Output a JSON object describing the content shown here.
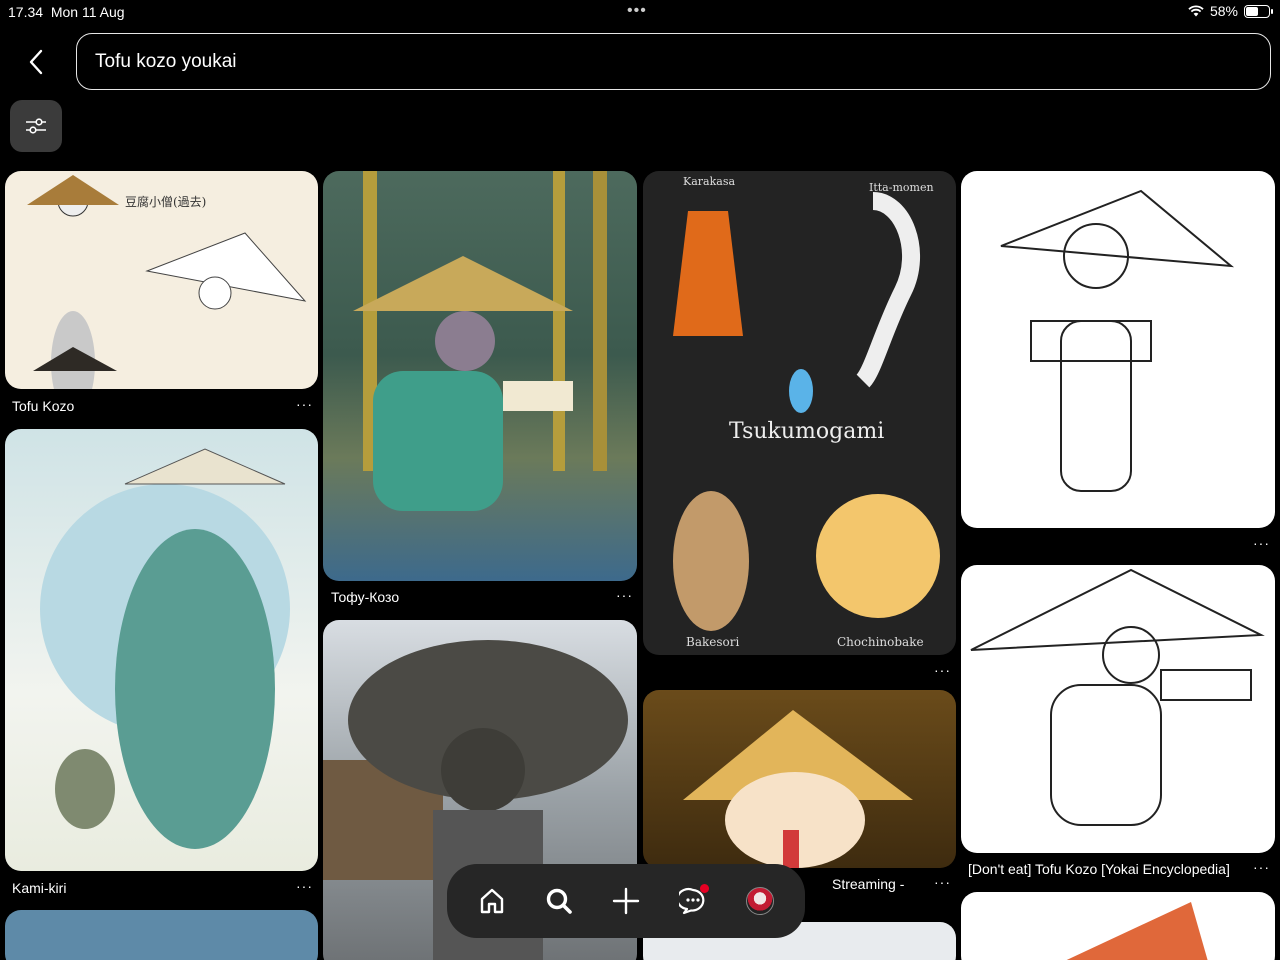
{
  "status": {
    "time": "17.34",
    "date": "Mon 11 Aug",
    "battery": "58%",
    "battery_level": 0.58
  },
  "search": {
    "value": "Tofu kozo youkai"
  },
  "pins": [
    {
      "caption": "Tofu Kozo"
    },
    {
      "caption": "Kami-kiri"
    },
    {
      "caption": "Тофу-Козо"
    },
    {
      "caption": ""
    },
    {
      "caption": ""
    },
    {
      "caption": "Streaming  -"
    },
    {
      "caption": ""
    },
    {
      "caption": "[Don't eat] Tofu Kozo [Yokai Encyclopedia]"
    }
  ],
  "pin_text": {
    "pin1_label": "豆腐小僧(過去)",
    "pin3_labels": [
      "Karakasa",
      "Itta-momen",
      "Tsukumogami",
      "Bakesori",
      "Chochinobake"
    ]
  },
  "more_label": "···",
  "nav": {
    "items": [
      "home-icon",
      "search-icon",
      "plus-icon",
      "messages-icon",
      "profile-avatar"
    ]
  }
}
